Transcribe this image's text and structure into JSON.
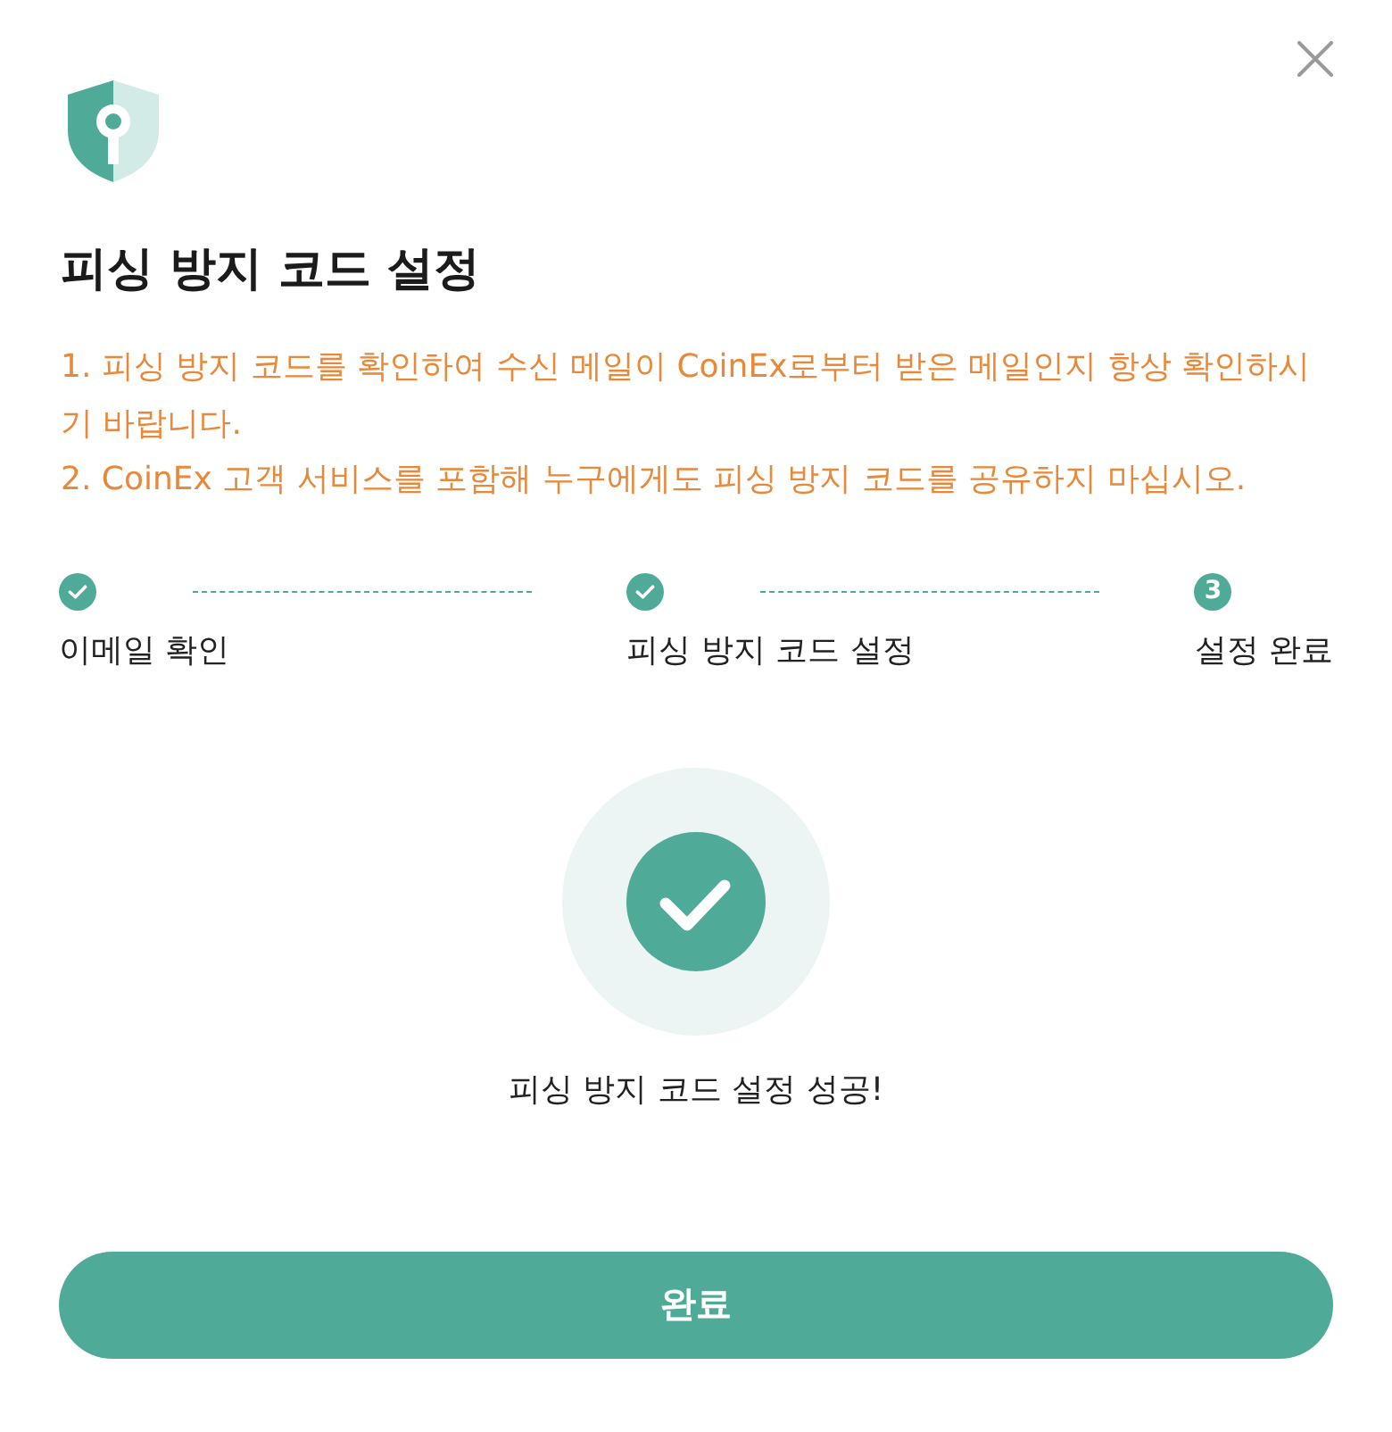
{
  "title": "피싱 방지 코드 설정",
  "notices": [
    "1. 피싱 방지 코드를 확인하여 수신 메일이 CoinEx로부터 받은 메일인지 항상 확인하시기 바랍니다.",
    "2. CoinEx 고객 서비스를 포함해 누구에게도 피싱 방지 코드를 공유하지 마십시오."
  ],
  "steps": [
    {
      "label": "이메일 확인",
      "completed": true
    },
    {
      "label": "피싱 방지 코드 설정",
      "completed": true
    },
    {
      "label": "설정 완료",
      "completed": false,
      "number": "3"
    }
  ],
  "result": {
    "message": "피싱 방지 코드 설정 성공!"
  },
  "button": {
    "label": "완료"
  }
}
